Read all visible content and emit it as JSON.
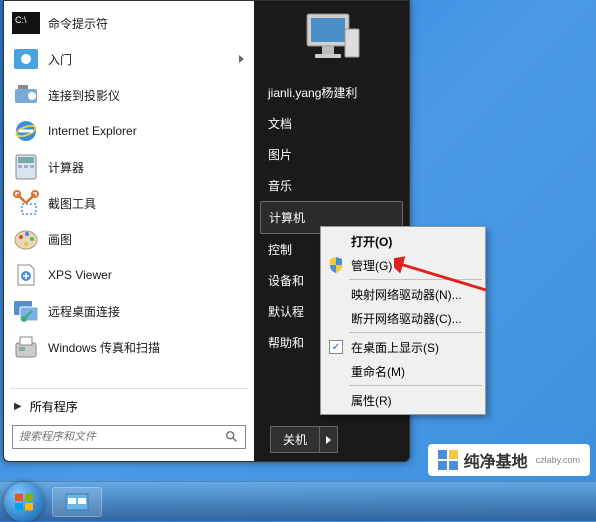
{
  "programs": [
    {
      "label": "命令提示符",
      "icon": "cmd",
      "sub": false
    },
    {
      "label": "入门",
      "icon": "getstarted",
      "sub": true
    },
    {
      "label": "连接到投影仪",
      "icon": "projector",
      "sub": false
    },
    {
      "label": "Internet Explorer",
      "icon": "ie",
      "sub": false
    },
    {
      "label": "计算器",
      "icon": "calc",
      "sub": false
    },
    {
      "label": "截图工具",
      "icon": "snip",
      "sub": false
    },
    {
      "label": "画图",
      "icon": "paint",
      "sub": false
    },
    {
      "label": "XPS Viewer",
      "icon": "xps",
      "sub": false
    },
    {
      "label": "远程桌面连接",
      "icon": "rdp",
      "sub": false
    },
    {
      "label": "Windows 传真和扫描",
      "icon": "fax",
      "sub": false
    }
  ],
  "all_programs": "所有程序",
  "search_placeholder": "搜索程序和文件",
  "user_name": "jianli.yang杨建利",
  "right_items": [
    {
      "label": "文档"
    },
    {
      "label": "图片"
    },
    {
      "label": "音乐"
    },
    {
      "label": "计算机",
      "boxed": true
    },
    {
      "label": "控制",
      "boxed": false
    },
    {
      "label": "设备和",
      "boxed": false
    },
    {
      "label": "默认程",
      "boxed": false
    },
    {
      "label": "帮助和",
      "boxed": false
    }
  ],
  "shutdown_label": "关机",
  "context_menu": [
    {
      "label": "打开(O)",
      "bold": true,
      "icon": null
    },
    {
      "label": "管理(G)",
      "bold": false,
      "icon": "shield"
    },
    {
      "sep": true
    },
    {
      "label": "映射网络驱动器(N)...",
      "bold": false,
      "icon": null
    },
    {
      "label": "断开网络驱动器(C)...",
      "bold": false,
      "icon": null
    },
    {
      "sep": true
    },
    {
      "label": "在桌面上显示(S)",
      "bold": false,
      "icon": "check"
    },
    {
      "label": "重命名(M)",
      "bold": false,
      "icon": null
    },
    {
      "sep": true
    },
    {
      "label": "属性(R)",
      "bold": false,
      "icon": null
    }
  ],
  "watermark": {
    "brand": "纯净基地",
    "url": "czlaby.com"
  }
}
